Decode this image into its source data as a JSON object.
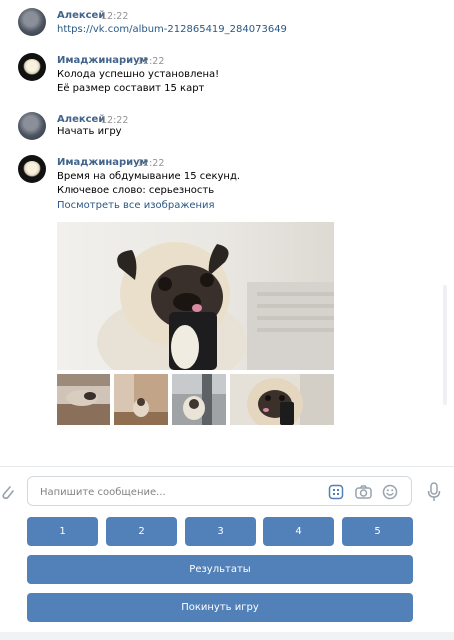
{
  "messages": [
    {
      "author": "Алексей",
      "time": "12:22",
      "lines": [
        "https://vk.com/album-212865419_284073649"
      ]
    },
    {
      "author": "Имаджинариум",
      "time": "12:22",
      "lines": [
        "Колода успешно установлена!",
        "Её размер составит 15 карт"
      ]
    },
    {
      "author": "Алексей",
      "time": "12:22",
      "lines": [
        "Начать игру"
      ]
    },
    {
      "author": "Имаджинариум",
      "time": "12:22",
      "lines": [
        "Время на обдумывание 15 секунд.",
        "Ключевое слово: серьезность"
      ],
      "link": "Посмотреть все изображения"
    }
  ],
  "composer": {
    "placeholder": "Напишите сообщение..."
  },
  "keyboard": {
    "numbers": [
      "1",
      "2",
      "3",
      "4",
      "5"
    ],
    "results_label": "Результаты",
    "leave_label": "Покинуть игру"
  },
  "colors": {
    "accent": "#5181b8",
    "author": "#42648b",
    "link": "#2a5885"
  },
  "icons": [
    "paperclip-icon",
    "keyboard-icon",
    "camera-icon",
    "emoji-icon",
    "microphone-icon"
  ]
}
